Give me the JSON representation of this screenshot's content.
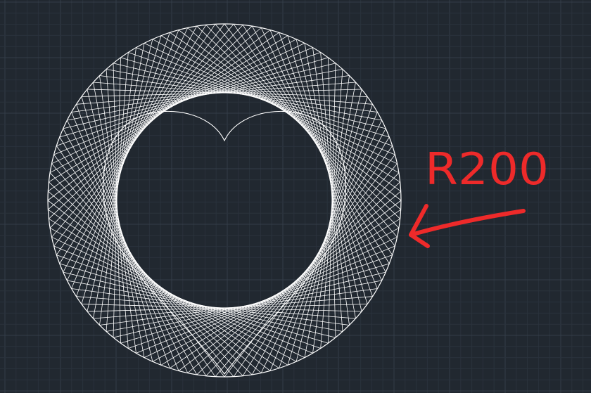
{
  "drawing": {
    "annotation_label": "R200",
    "colors": {
      "background": "#212830",
      "grid_minor": "#2a323c",
      "grid_major": "#343d48",
      "lines": "#ffffff",
      "annotation": "#ee2a2a"
    }
  }
}
